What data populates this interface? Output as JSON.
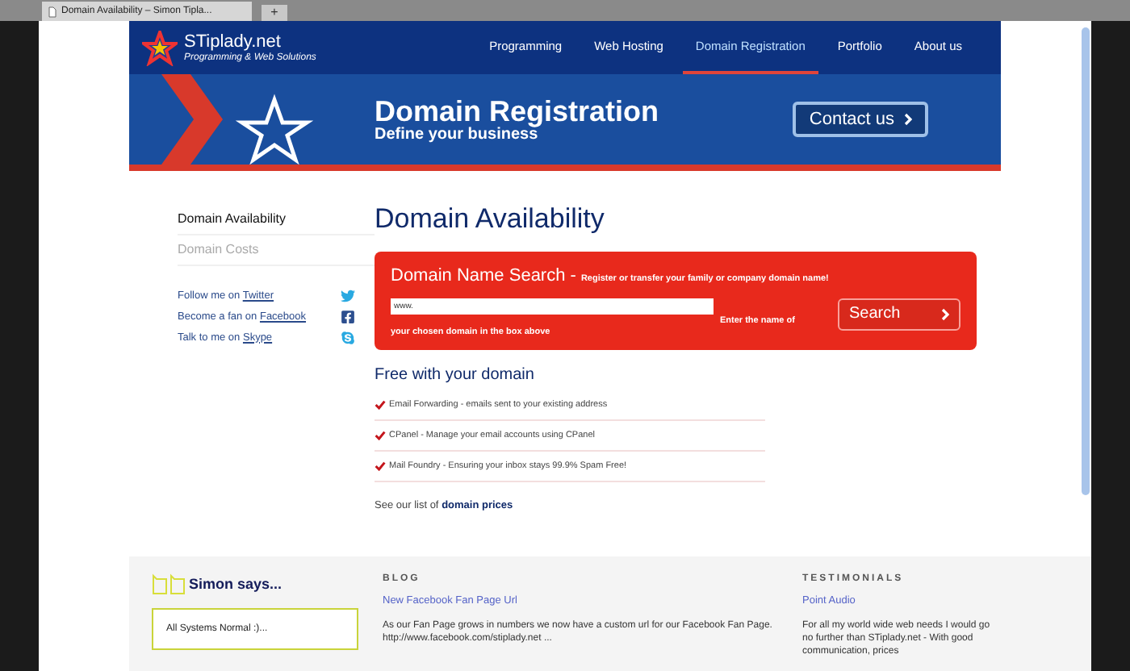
{
  "browser": {
    "tab_title": "Domain Availability – Simon Tipla...",
    "new_tab": "+"
  },
  "site": {
    "logo_name": "STiplady.net",
    "logo_tagline": "Programming & Web Solutions"
  },
  "nav": [
    {
      "label": "Programming",
      "selected": false
    },
    {
      "label": "Web Hosting",
      "selected": false
    },
    {
      "label": "Domain Registration",
      "selected": true
    },
    {
      "label": "Portfolio",
      "selected": false
    },
    {
      "label": "About us",
      "selected": false
    }
  ],
  "banner": {
    "title": "Domain Registration",
    "subtitle": "Define your business",
    "contact": "Contact us"
  },
  "sidebar": {
    "items": [
      {
        "label": "Domain Availability",
        "selected": true
      },
      {
        "label": "Domain Costs",
        "selected": false
      }
    ],
    "social": [
      {
        "kind": "twitter",
        "text": "Follow me on",
        "link": "Twitter"
      },
      {
        "kind": "facebook",
        "text": "Become a fan on",
        "link": "Facebook"
      },
      {
        "kind": "skype",
        "text": "Talk to me on",
        "link": "Skype"
      }
    ]
  },
  "main": {
    "heading": "Domain Availability",
    "search": {
      "title": "Domain Name Search -",
      "subtitle": "Register or transfer your family or company domain name!",
      "value": "www.",
      "hint": "Enter the name of your chosen domain in the box above",
      "button": "Search"
    },
    "free_heading": "Free with your domain",
    "features": [
      "Email Forwarding - emails sent to your existing address",
      "CPanel - Manage your email accounts using CPanel",
      "Mail Foundry - Ensuring your inbox stays 99.9% Spam Free!"
    ],
    "prices_text": "See our list of",
    "prices_link": "domain prices"
  },
  "footer": {
    "simon_title": "Simon says...",
    "status": "All Systems Normal :)...",
    "blog_label": "BLOG",
    "blog_link": "New Facebook Fan Page Url",
    "blog_text": "As our Fan Page grows in numbers we now have a custom url for our Facebook Fan Page. http://www.facebook.com/stiplady.net ...",
    "testimonials_label": "TESTIMONIALS",
    "testimonial_link": "Point Audio",
    "testimonial_text": "For all my world wide web needs I would go no further than STiplady.net - With good communication, prices"
  }
}
